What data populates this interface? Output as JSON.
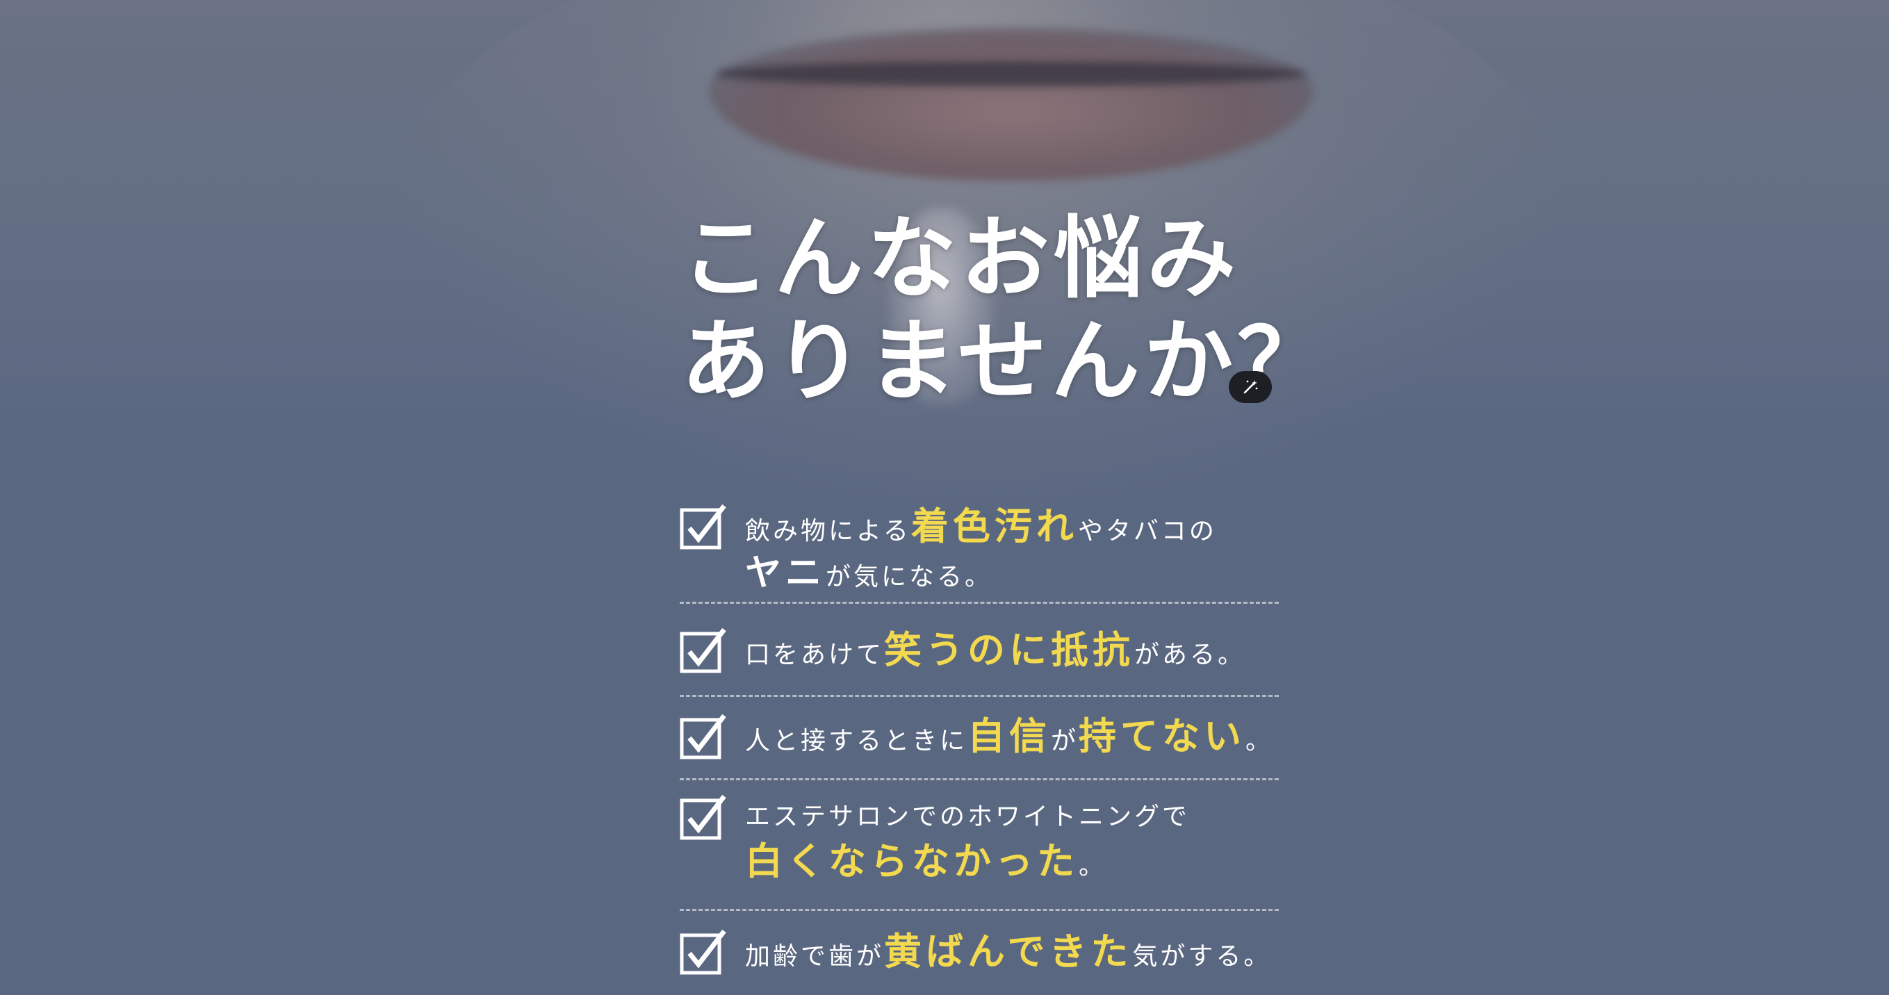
{
  "heading": {
    "line1": "こんなお悩み",
    "line2": "ありませんか？"
  },
  "badge": {
    "icon": "magic-wand-icon"
  },
  "checklist": {
    "icon": "checkbox-checked-icon",
    "colors": {
      "highlight": "#f2d94f",
      "text": "#ffffff",
      "background": "#5a6780"
    },
    "items": [
      {
        "l1_a": "飲み物による",
        "l1_hl": "着色汚れ",
        "l1_b": "やタバコの",
        "l2_big": "ヤニ",
        "l2_b": "が気になる。"
      },
      {
        "a": "口をあけて",
        "hl": "笑うのに抵抗",
        "b": "がある。"
      },
      {
        "a": "人と接するときに",
        "hl1": "自信",
        "mid": "が",
        "hl2": "持てない",
        "b": "。"
      },
      {
        "l1": "エステサロンでのホワイトニングで",
        "l2_hl": "白くならなかった",
        "l2_b": "。"
      },
      {
        "a": "加齢で歯が",
        "hl": "黄ばんできた",
        "b": "気がする。"
      }
    ]
  }
}
